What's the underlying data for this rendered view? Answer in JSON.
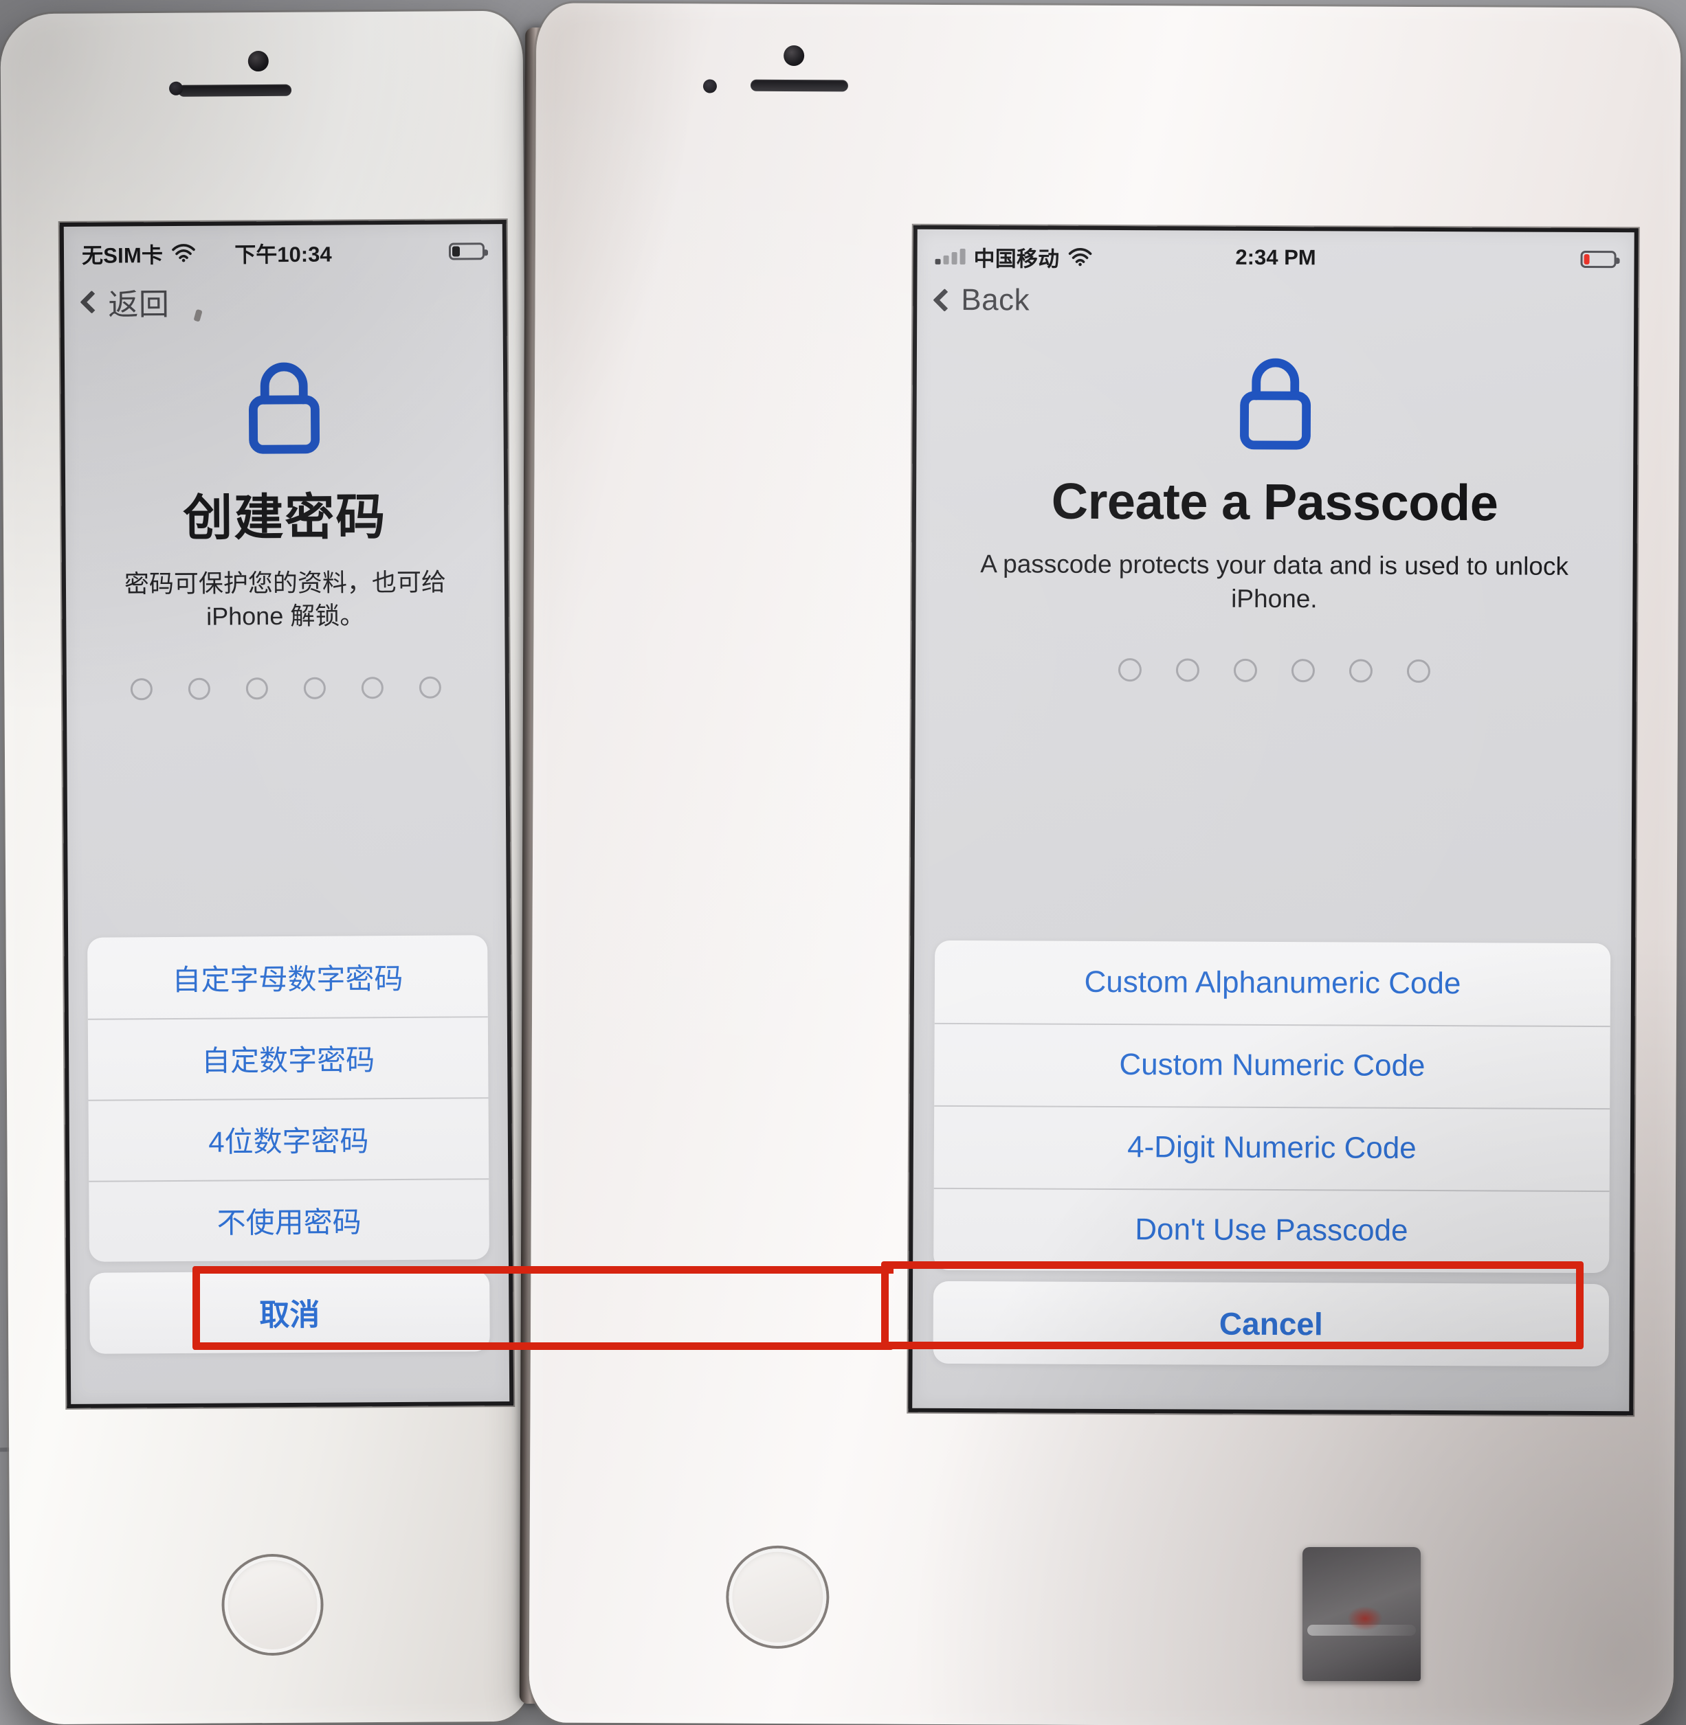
{
  "scene": {
    "description": "Two iPhones side by side showing the Create a Passcode setup screen, one in Chinese and one in English, with red annotation boxes around the Don't Use Passcode option"
  },
  "annotation": {
    "color": "#d62410",
    "target_left": "不使用密码",
    "target_right": "Don't Use Passcode"
  },
  "phone_left": {
    "status_bar": {
      "carrier": "无SIM卡",
      "wifi_icon": "wifi-icon",
      "time": "下午10:34",
      "battery_icon": "battery-icon",
      "battery_color": "#1f1f22",
      "battery_level_percent": 25
    },
    "nav": {
      "back_icon": "chevron-left-icon",
      "back_label": "返回"
    },
    "hero": {
      "lock_icon": "lock-icon",
      "lock_color": "#1a4fbd",
      "title": "创建密码",
      "subtitle": "密码可保护您的资料，也可给 iPhone 解锁。"
    },
    "passcode_dots": {
      "count": 6,
      "filled": 0
    },
    "sheet": {
      "options": [
        "自定字母数字密码",
        "自定数字密码",
        "4位数字密码",
        "不使用密码"
      ],
      "cancel_label": "取消"
    }
  },
  "phone_right": {
    "status_bar": {
      "signal_icon": "signal-bars-icon",
      "carrier": "中国移动",
      "wifi_icon": "wifi-icon",
      "time": "2:34 PM",
      "battery_icon": "battery-icon",
      "battery_color": "#e8342a",
      "battery_level_percent": 20
    },
    "nav": {
      "back_icon": "chevron-left-icon",
      "back_label": "Back"
    },
    "hero": {
      "lock_icon": "lock-icon",
      "lock_color": "#1a4fbd",
      "title": "Create a Passcode",
      "subtitle": "A passcode protects your data and is used to unlock iPhone."
    },
    "passcode_dots": {
      "count": 6,
      "filled": 0
    },
    "sheet": {
      "options": [
        "Custom Alphanumeric Code",
        "Custom Numeric Code",
        "4-Digit Numeric Code",
        "Don't Use Passcode"
      ],
      "cancel_label": "Cancel"
    }
  }
}
